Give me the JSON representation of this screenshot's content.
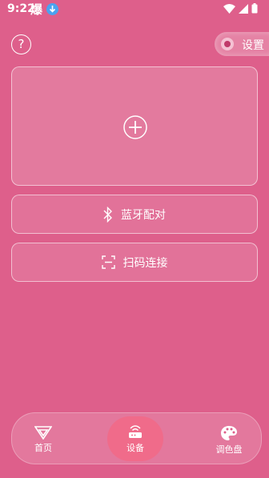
{
  "status": {
    "time": "9:22",
    "app_glyph": "爆"
  },
  "header": {
    "help_glyph": "?",
    "settings_label": "设置"
  },
  "cards": {
    "bluetooth_label": "蓝牙配对",
    "scan_label": "扫码连接"
  },
  "tabs": [
    {
      "label": "首页",
      "icon": "home-icon"
    },
    {
      "label": "设备",
      "icon": "device-icon"
    },
    {
      "label": "调色盘",
      "icon": "palette-icon"
    }
  ],
  "colors": {
    "background": "#de5f8b",
    "active_tab": "#f06b8a"
  }
}
